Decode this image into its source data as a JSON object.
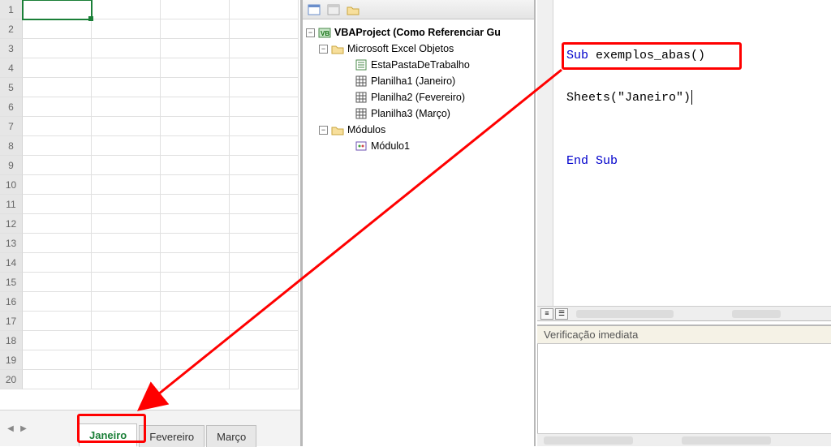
{
  "excel": {
    "row_numbers": [
      "1",
      "2",
      "3",
      "4",
      "5",
      "6",
      "7",
      "8",
      "9",
      "10",
      "11",
      "12",
      "13",
      "14",
      "15",
      "16",
      "17",
      "18",
      "19",
      "20"
    ],
    "sheet_tabs": [
      {
        "label": "Janeiro",
        "active": true
      },
      {
        "label": "Fevereiro",
        "active": false
      },
      {
        "label": "Março",
        "active": false
      }
    ]
  },
  "project_explorer": {
    "root": "VBAProject (Como Referenciar Gu",
    "folder_objs": "Microsoft Excel Objetos",
    "items_objs": [
      "EstaPastaDeTrabalho",
      "Planilha1 (Janeiro)",
      "Planilha2 (Fevereiro)",
      "Planilha3 (Março)"
    ],
    "folder_mods": "Módulos",
    "items_mods": [
      "Módulo1"
    ]
  },
  "code": {
    "line1_kw": "Sub",
    "line1_rest": " exemplos_abas()",
    "line3": "Sheets(\"Janeiro\")",
    "line5_kw1": "End",
    "line5_kw2": "Sub"
  },
  "immediate_window_title": "Verificação imediata"
}
